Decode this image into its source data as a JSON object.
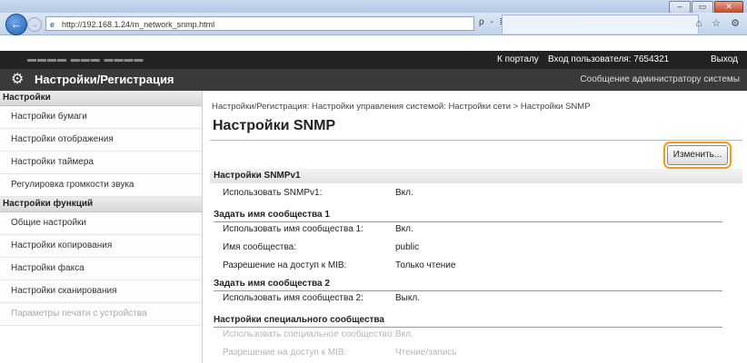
{
  "browser": {
    "url": "http://192.168.1.24/m_network_snmp.html",
    "address_controls": "ρ - ≣ c ×",
    "toolbar_icons": "⌂ ☆ ⚙",
    "window_buttons": [
      "–",
      "▭",
      "✕"
    ]
  },
  "topbar": {
    "portal_link": "К порталу",
    "user_info": "Вход пользователя: 7654321",
    "logout_link": "Выход"
  },
  "header": {
    "title": "Настройки/Регистрация",
    "admin_message": "Сообщение администратору системы"
  },
  "sidebar": {
    "section1": "Настройки",
    "items1": [
      "Настройки бумаги",
      "Настройки отображения",
      "Настройки таймера",
      "Регулировка громкости звука"
    ],
    "section2": "Настройки функций",
    "items2": [
      "Общие настройки",
      "Настройки копирования",
      "Настройки факса",
      "Настройки сканирования",
      "Параметры печати с устройства"
    ]
  },
  "main": {
    "breadcrumb": "Настройки/Регистрация: Настройки управления системой: Настройки сети > Настройки SNMP",
    "title": "Настройки SNMP",
    "edit_button": "Изменить...",
    "snmpv1_section": "Настройки SNMPv1",
    "use_snmpv1_label": "Использовать SNMPv1:",
    "use_snmpv1_value": "Вкл.",
    "community1_header": "Задать имя сообщества 1",
    "use_community1_label": "Использовать имя сообщества 1:",
    "use_community1_value": "Вкл.",
    "community_name_label": "Имя сообщества:",
    "community_name_value": "public",
    "mib_access_label": "Разрешение на доступ к MIB:",
    "mib_access_value": "Только чтение",
    "community2_header": "Задать имя сообщества 2",
    "use_community2_label": "Использовать имя сообщества 2:",
    "use_community2_value": "Выкл.",
    "special_header": "Настройки специального сообщества",
    "use_special_label": "Использовать специальное сообщество:",
    "use_special_value": "Вкл.",
    "special_mib_label": "Разрешение на доступ к MIB:",
    "special_mib_value": "Чтение/запись"
  }
}
